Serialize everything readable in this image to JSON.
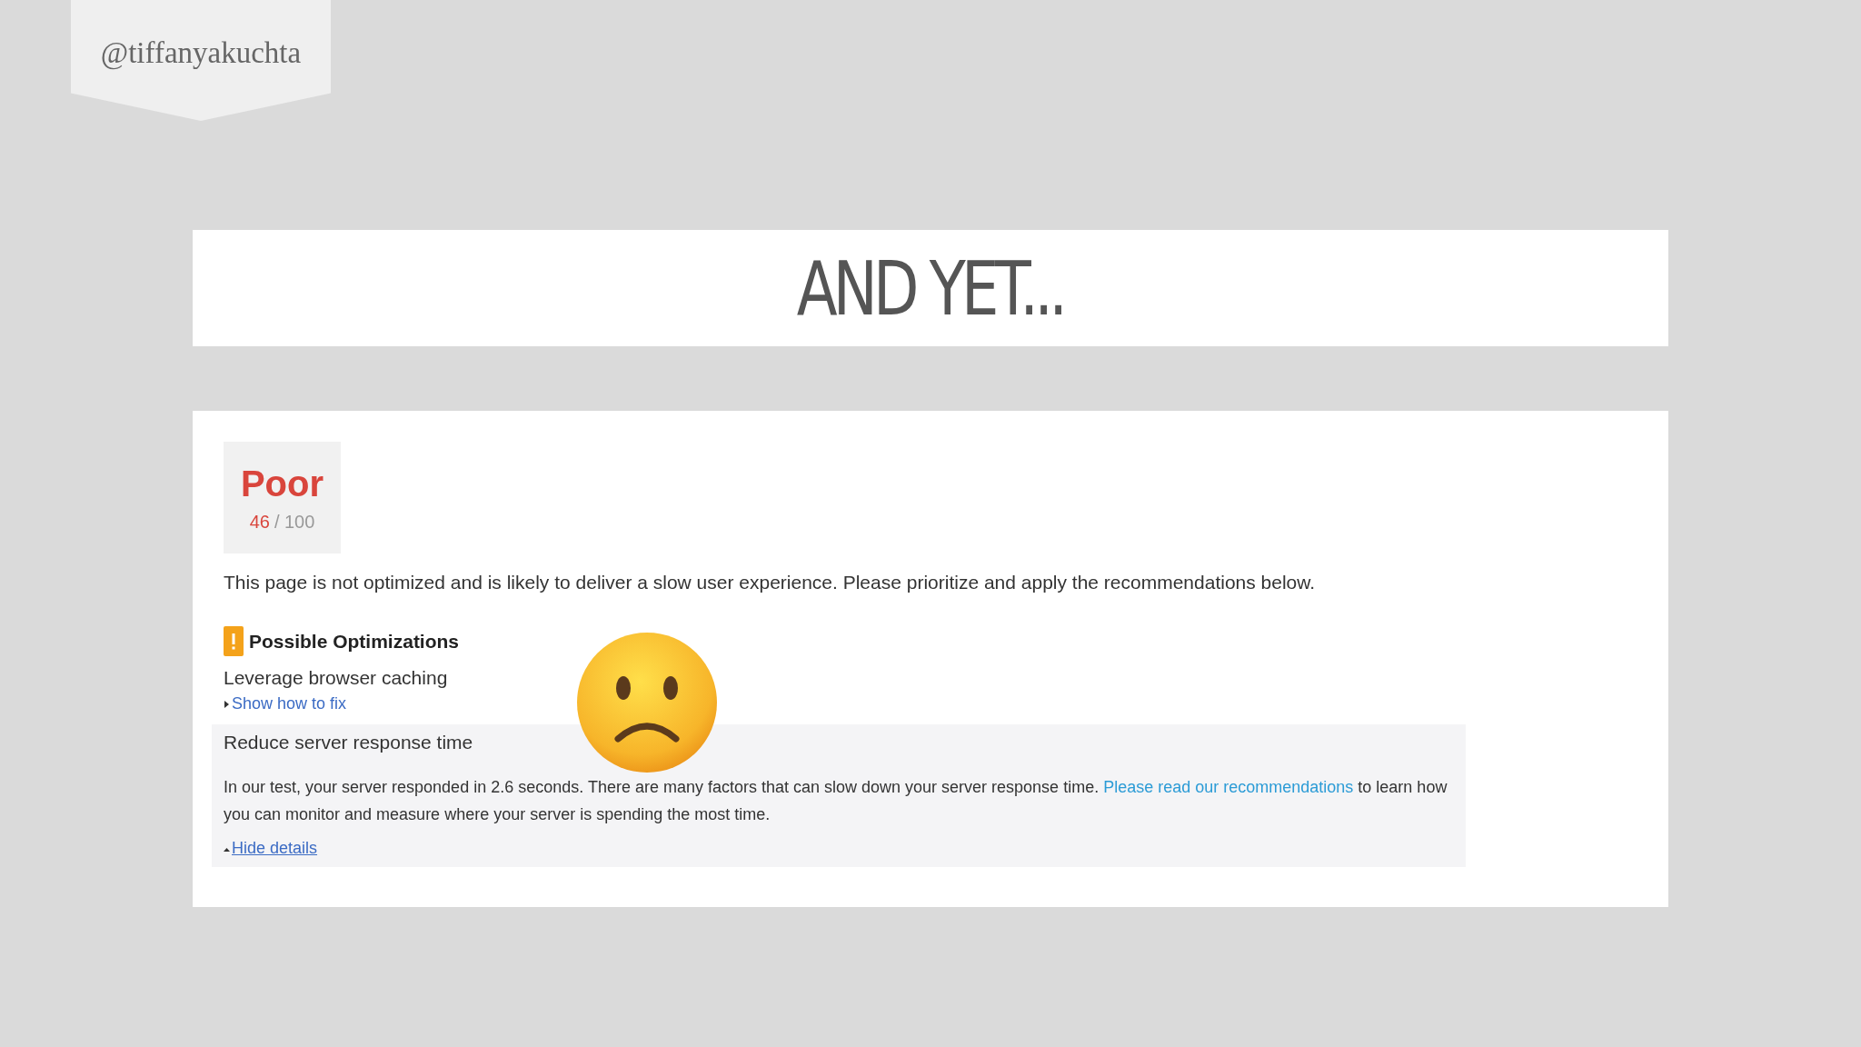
{
  "handle": "@tiffanyakuchta",
  "title": "AND YET...",
  "report": {
    "verdict": "Poor",
    "score": "46",
    "max": "/ 100",
    "summary": "This page is not optimized and is likely to deliver a slow user experience. Please prioritize and apply the recommendations below.",
    "section_title": "Possible Optimizations",
    "rules": [
      {
        "title": "Leverage browser caching",
        "expanded": false,
        "toggle": "Show how to fix"
      },
      {
        "title": "Reduce server response time",
        "expanded": true,
        "details_before": "In our test, your server responded in 2.6 seconds. There are many factors that can slow down your server response time.",
        "details_link": "Please read our recommendations",
        "details_after": "to learn how you can monitor and measure where your server is spending the most time.",
        "toggle": "Hide details"
      }
    ]
  }
}
